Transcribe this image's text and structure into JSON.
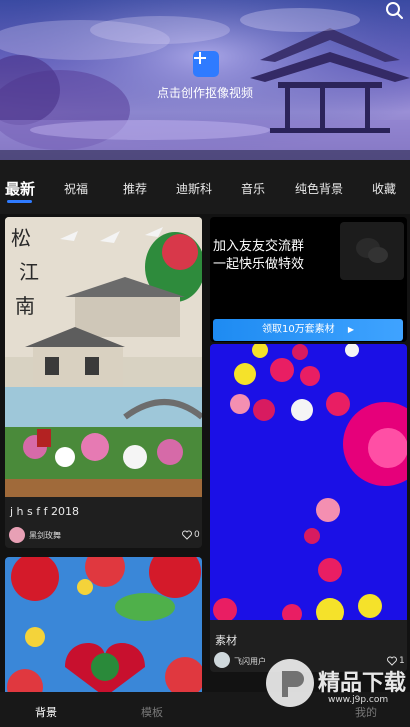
{
  "banner": {
    "create_label": "点击创作抠像视频"
  },
  "tabs": [
    {
      "label": "最新",
      "active": true
    },
    {
      "label": "祝福",
      "active": false
    },
    {
      "label": "推荐",
      "active": false
    },
    {
      "label": "迪斯科",
      "active": false
    },
    {
      "label": "音乐",
      "active": false
    },
    {
      "label": "纯色背景",
      "active": false
    },
    {
      "label": "收藏",
      "active": false
    }
  ],
  "feed": {
    "card1": {
      "title": "j h s f f 2018",
      "author": "黑剑玫舞",
      "likes": "0"
    },
    "promo": {
      "line1": "加入友友交流群",
      "line2": "一起快乐做特效",
      "button": "领取10万套素材",
      "button_icon": "play-arrow-icon"
    },
    "card2": {
      "title": "素材",
      "author": "飞闪用户",
      "likes": "1"
    }
  },
  "bottom_nav": [
    {
      "label": "背景",
      "active": true
    },
    {
      "label": "模板",
      "active": false
    },
    {
      "label": "",
      "active": false
    },
    {
      "label": "我的",
      "active": false
    }
  ],
  "watermark": {
    "text": "精品下载",
    "url": "www.j9p.com"
  },
  "colors": {
    "accent": "#2f7bff",
    "bg": "#121212"
  }
}
